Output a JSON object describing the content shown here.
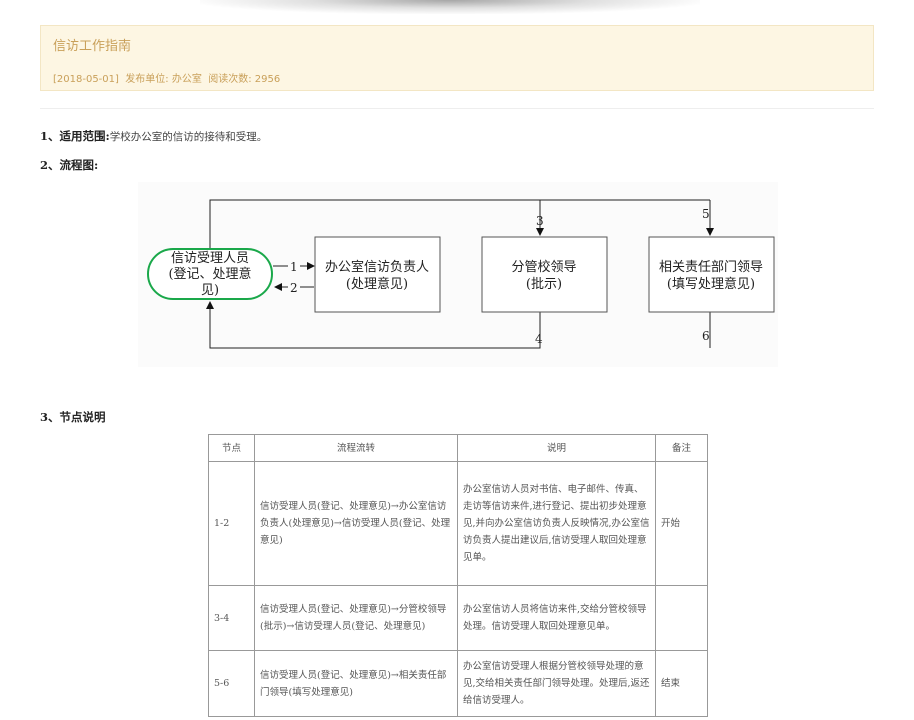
{
  "header": {
    "title": "信访工作指南",
    "date": "[2018-05-01]",
    "publisher_label": "发布单位:",
    "publisher": "办公室",
    "views_label": "阅读次数:",
    "views": "2956"
  },
  "sections": {
    "scope_heading": "1、适用范围:",
    "scope_text": "学校办公室的信访的接待和受理。",
    "flow_heading": "2、流程图:",
    "nodes_heading": "3、节点说明"
  },
  "flowchart": {
    "start_line1": "信访受理人员",
    "start_line2": "(登记、处理意",
    "start_line3": "见)",
    "box1_line1": "办公室信访负责人",
    "box1_line2": "(处理意见)",
    "box2_line1": "分管校领导",
    "box2_line2": "(批示)",
    "box3_line1": "相关责任部门领导",
    "box3_line2": "(填写处理意见)",
    "n1": "1",
    "n2": "2",
    "n3": "3",
    "n4": "4",
    "n5": "5",
    "n6": "6",
    "start_border_color": "#1aa84a"
  },
  "table": {
    "headers": [
      "节点",
      "流程流转",
      "说明",
      "备注"
    ],
    "rows": [
      {
        "node": "1-2",
        "flow": "信访受理人员(登记、处理意见)→办公室信访负责人(处理意见)→信访受理人员(登记、处理意见)",
        "desc": "办公室信访人员对书信、电子邮件、传真、走访等信访来件,进行登记、提出初步处理意见,并向办公室信访负责人反映情况,办公室信访负责人提出建议后,信访受理人取回处理意见单。",
        "note": "开始"
      },
      {
        "node": "3-4",
        "flow": "信访受理人员(登记、处理意见)→分管校领导(批示)→信访受理人员(登记、处理意见)",
        "desc": "办公室信访人员将信访来件,交给分管校领导处理。信访受理人取回处理意见单。",
        "note": ""
      },
      {
        "node": "5-6",
        "flow": "信访受理人员(登记、处理意见)→相关责任部门领导(填写处理意见)",
        "desc": "办公室信访受理人根据分管校领导处理的意见,交给相关责任部门领导处理。处理后,返还给信访受理人。",
        "note": "结束"
      }
    ]
  }
}
